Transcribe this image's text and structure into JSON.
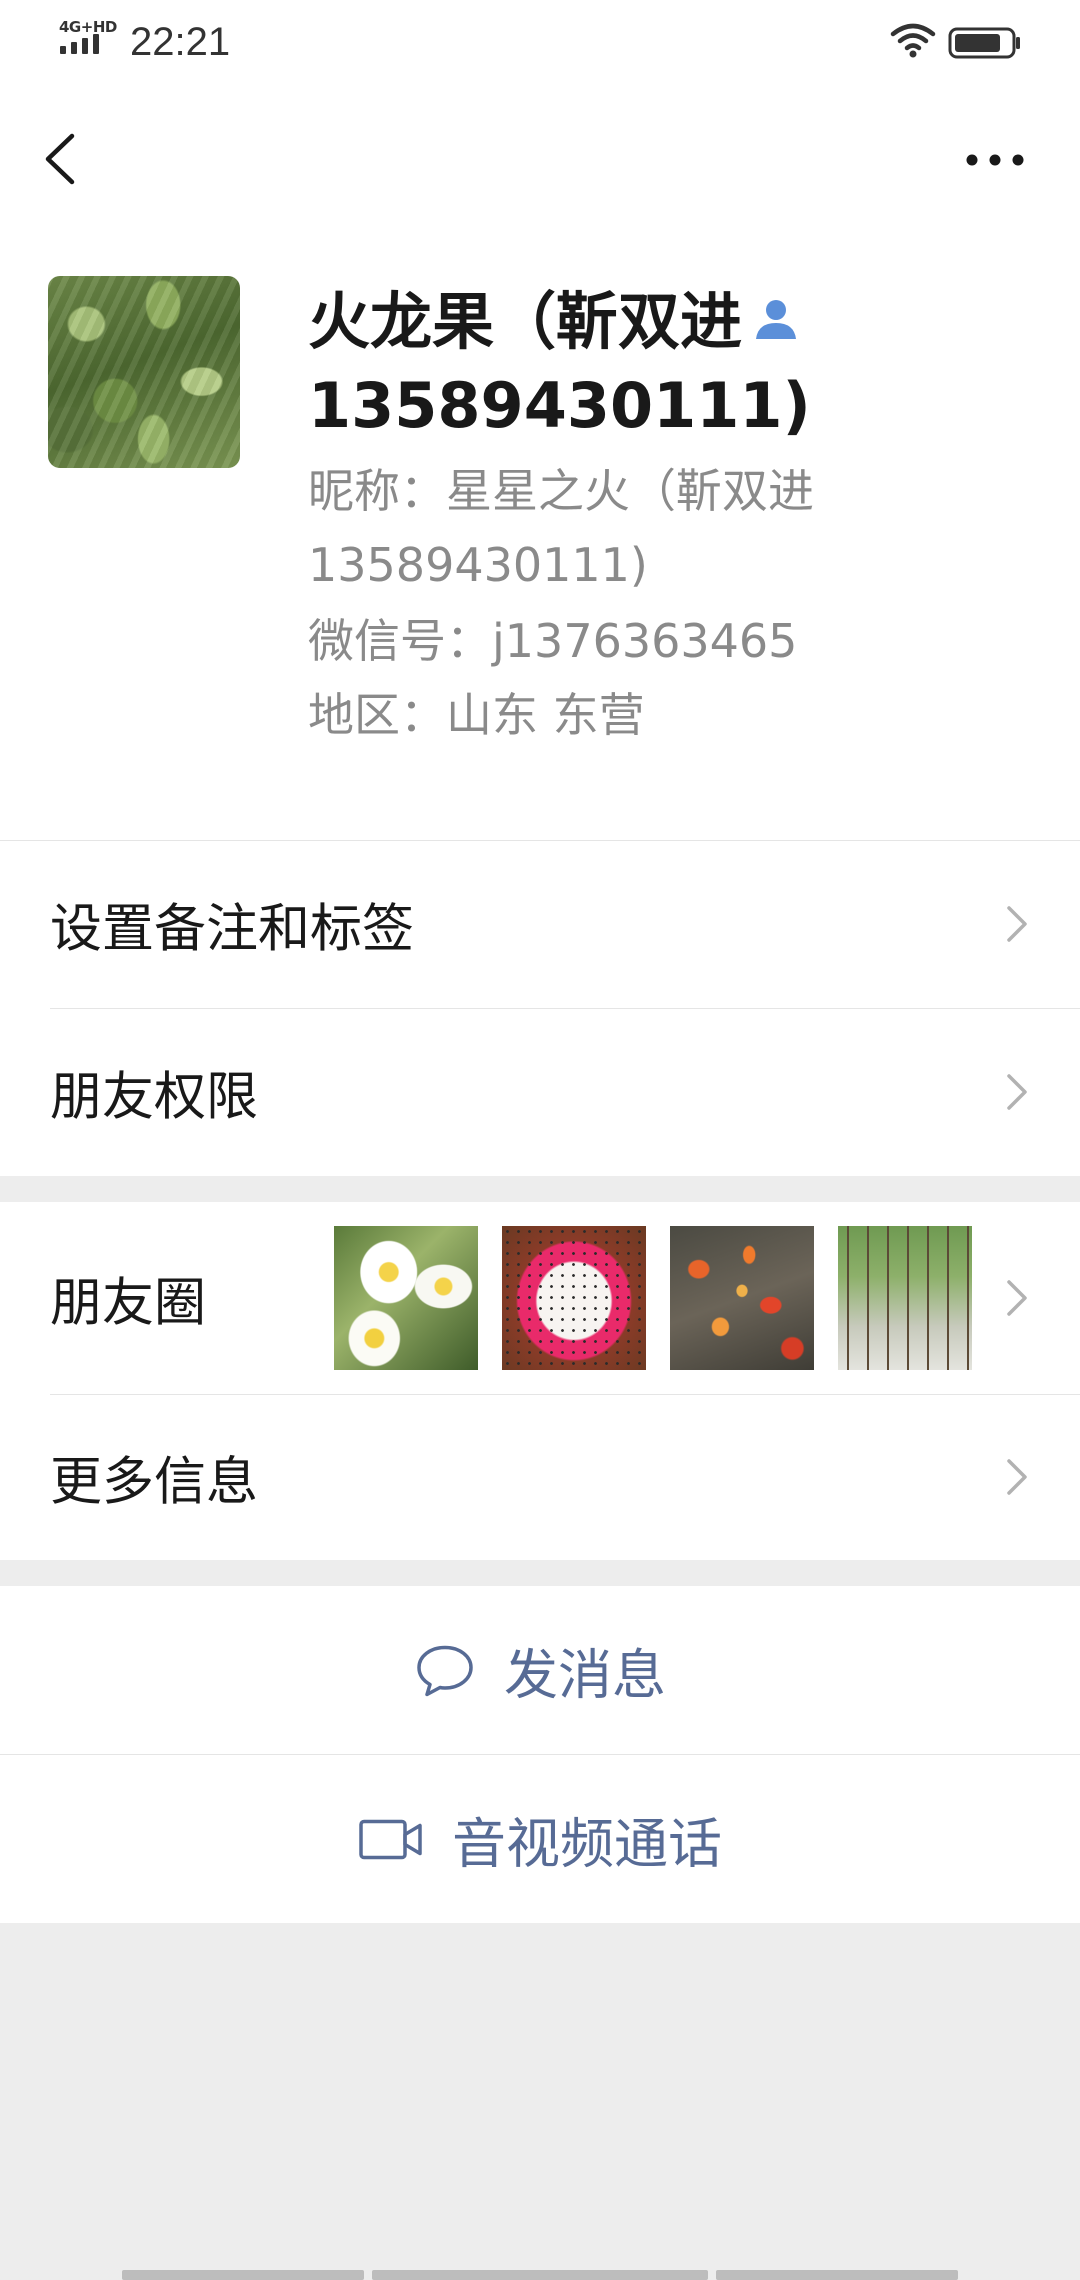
{
  "status_bar": {
    "network": "4G+HD",
    "time": "22:21"
  },
  "profile": {
    "name_line1": "火龙果（靳双进",
    "name_line2": "13589430111)",
    "nickname_line1": "昵称：星星之火（靳双进",
    "nickname_line2": "13589430111)",
    "wechat_id": "微信号：j1376363465",
    "region": "地区：山东  东营"
  },
  "menu": {
    "set_remark": "设置备注和标签",
    "friend_permissions": "朋友权限",
    "moments": "朋友圈",
    "more_info": "更多信息"
  },
  "actions": {
    "send_message": "发消息",
    "video_call": "音视频通话"
  },
  "colors": {
    "accent": "#576b95",
    "background": "#ededed",
    "contact_icon": "#5b8fd9"
  },
  "icons": {
    "back": "back-chevron-icon",
    "more": "more-dots-icon",
    "contact": "contact-person-icon",
    "chat": "chat-bubble-icon",
    "video": "video-camera-icon"
  }
}
